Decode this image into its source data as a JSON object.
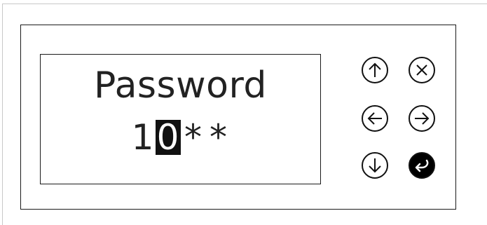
{
  "display": {
    "title": "Password",
    "digits": [
      "1",
      "0",
      "*",
      "*"
    ],
    "cursor_index": 1
  },
  "keypad": [
    {
      "name": "up",
      "icon": "arrow-up-icon"
    },
    {
      "name": "cancel",
      "icon": "close-icon"
    },
    {
      "name": "left",
      "icon": "arrow-left-icon"
    },
    {
      "name": "right",
      "icon": "arrow-right-icon"
    },
    {
      "name": "down",
      "icon": "arrow-down-icon"
    },
    {
      "name": "enter",
      "icon": "enter-icon"
    }
  ],
  "colors": {
    "border": "#1a1a1a",
    "text": "#222222",
    "cursor_bg": "#111111",
    "enter_button": "#000000"
  }
}
